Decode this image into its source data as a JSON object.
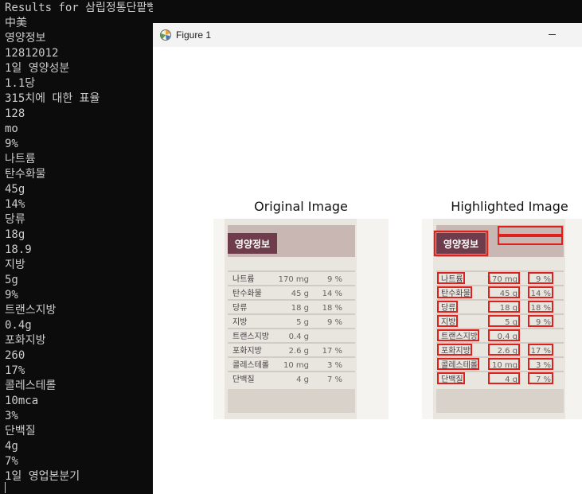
{
  "terminal": {
    "lines": [
      "Results for 삼립정통단팥빵.jpg:",
      "中美",
      "영양정보",
      "12812012",
      "1일 영양성분",
      "1.1당",
      "315치에 대한 표율",
      "128",
      "mo",
      "9%",
      "나트륨",
      "탄수화물",
      "45g",
      "14%",
      "당류",
      "18g",
      "18.9",
      "지방",
      "5g",
      "9%",
      "트랜스지방",
      "0.4g",
      "포화지방",
      "260",
      "17%",
      "콜레스테롤",
      "10mca",
      "3%",
      "단백질",
      "4g",
      "7%",
      "1일 영업본분기"
    ]
  },
  "figure": {
    "window_title": "Figure 1",
    "panels": [
      {
        "title": "Original Image"
      },
      {
        "title": "Highlighted Image"
      }
    ],
    "label_text": {
      "header": "영양정보",
      "rows": [
        {
          "name": "나트륨",
          "value": "170 mg",
          "pct": "9 %"
        },
        {
          "name": "탄수화물",
          "value": "45 g",
          "pct": "14 %"
        },
        {
          "name": "당류",
          "value": "18 g",
          "pct": "18 %"
        },
        {
          "name": "지방",
          "value": "5 g",
          "pct": "9 %"
        },
        {
          "name": "트랜스지방",
          "value": "0.4 g",
          "pct": ""
        },
        {
          "name": "포화지방",
          "value": "2.6 g",
          "pct": "17 %"
        },
        {
          "name": "콜레스테롤",
          "value": "10 mg",
          "pct": "3 %"
        },
        {
          "name": "단백질",
          "value": "4 g",
          "pct": "7 %"
        }
      ]
    },
    "highlight_color": "#e0201c"
  }
}
